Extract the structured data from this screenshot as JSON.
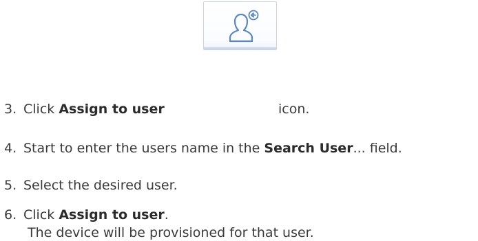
{
  "steps": [
    {
      "number": "3.",
      "prefix": "Click ",
      "bold": "Assign to user",
      "suffix": " icon.",
      "icon": "assign-user-icon"
    },
    {
      "number": "4.",
      "prefix": "Start to enter the users name in the ",
      "bold": "Search User",
      "suffix": "... field."
    },
    {
      "number": "5.",
      "text": "Select the desired user."
    },
    {
      "number": "6.",
      "prefix": "Click ",
      "bold": "Assign to user",
      "suffix": ".",
      "result": "The device will be provisioned for that user."
    }
  ],
  "colors": {
    "text": "#3a3a3a",
    "icon_stroke": "#5a86c2",
    "button_border": "#c9d3e6"
  }
}
